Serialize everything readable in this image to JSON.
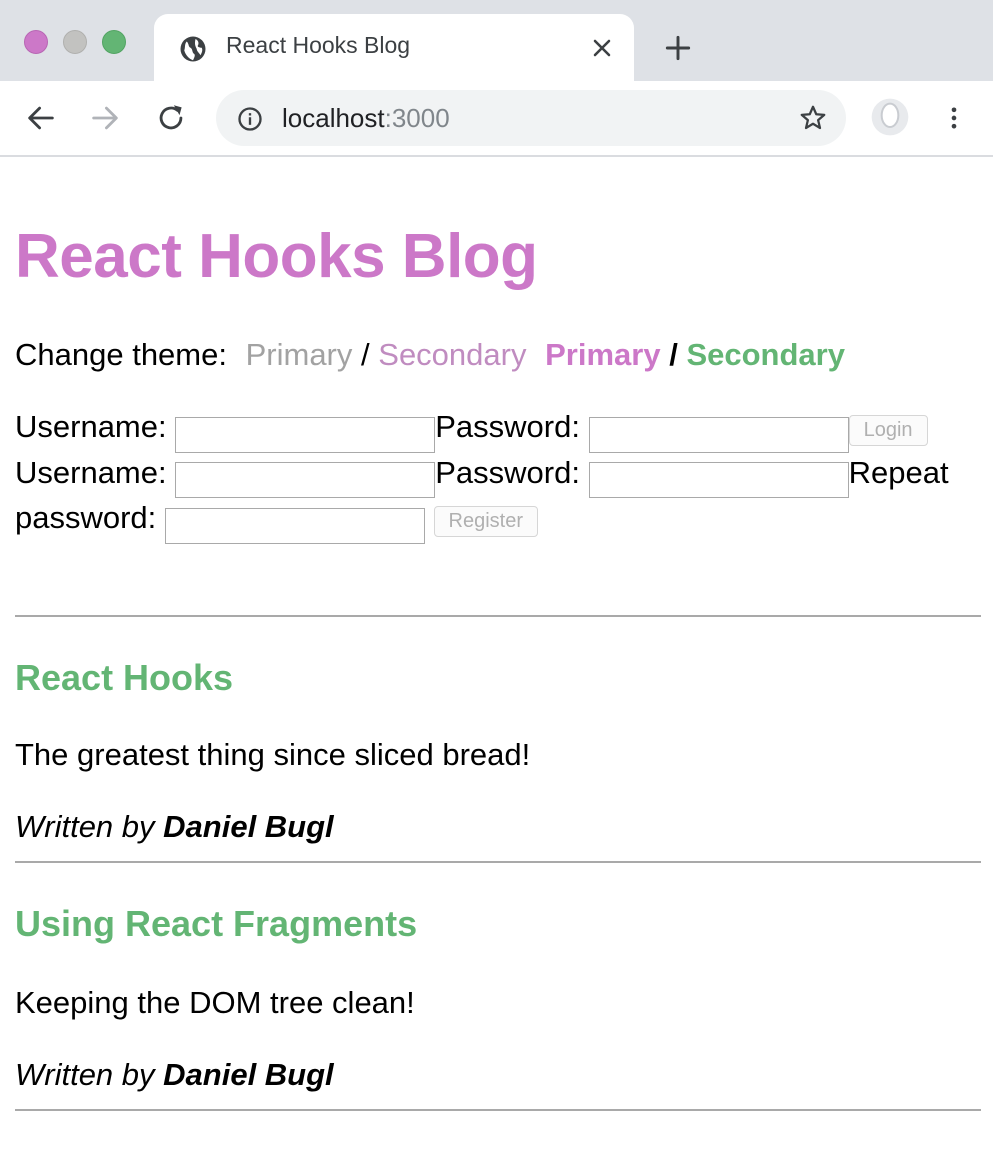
{
  "browser": {
    "tab_title": "React Hooks Blog",
    "url_host": "localhost",
    "url_port": ":3000"
  },
  "page": {
    "title": "React Hooks Blog",
    "theme": {
      "label": "Change theme:",
      "plain_primary": "Primary",
      "plain_slash": "/",
      "plain_secondary": "Secondary",
      "bold_primary": "Primary",
      "bold_slash": "/",
      "bold_secondary": "Secondary"
    },
    "login": {
      "username_label": "Username:",
      "password_label": "Password:",
      "username_value": "",
      "password_value": "",
      "button": "Login"
    },
    "register": {
      "username_label": "Username:",
      "password_label": "Password:",
      "repeat_label": "Repeat password:",
      "username_value": "",
      "password_value": "",
      "repeat_value": "",
      "button": "Register"
    },
    "posts": [
      {
        "title": "React Hooks",
        "content": "The greatest thing since sliced bread!",
        "written_by": "Written by",
        "author": "Daniel Bugl"
      },
      {
        "title": "Using React Fragments",
        "content": "Keeping the DOM tree clean!",
        "written_by": "Written by",
        "author": "Daniel Bugl"
      }
    ]
  },
  "colors": {
    "primary": "#cc78c8",
    "secondary": "#63b574"
  },
  "icons": [
    "globe-icon",
    "close-icon",
    "plus-icon",
    "back-icon",
    "forward-icon",
    "reload-icon",
    "info-icon",
    "star-icon",
    "profile-icon",
    "menu-icon"
  ]
}
